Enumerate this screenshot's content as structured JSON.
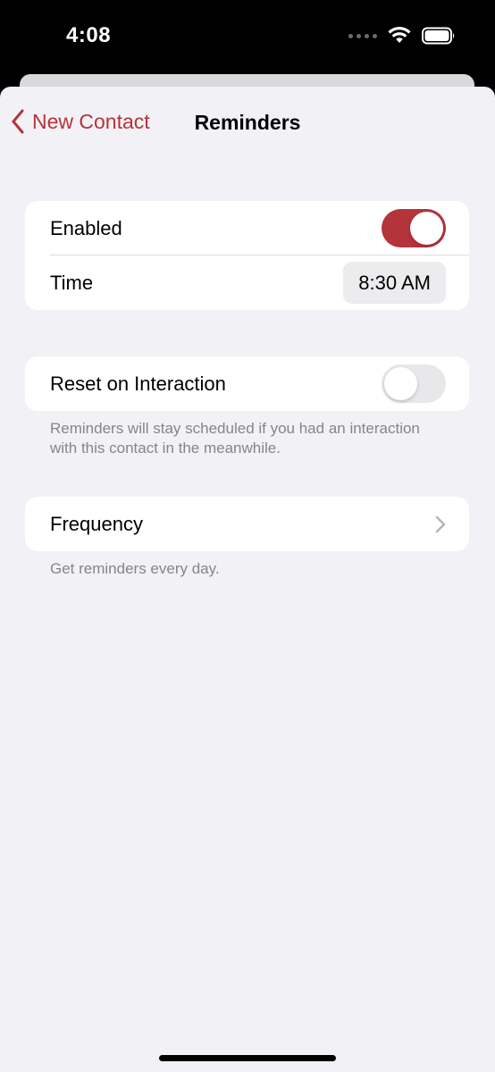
{
  "status_bar": {
    "time": "4:08"
  },
  "nav": {
    "back_label": "New Contact",
    "title": "Reminders"
  },
  "group1": {
    "enabled_label": "Enabled",
    "enabled_on": true,
    "time_label": "Time",
    "time_value": "8:30 AM"
  },
  "group2": {
    "reset_label": "Reset on Interaction",
    "reset_on": false,
    "footer": "Reminders will stay scheduled if you had an interaction with this contact in the meanwhile."
  },
  "group3": {
    "frequency_label": "Frequency",
    "footer": "Get reminders every day."
  },
  "colors": {
    "accent": "#b5333b",
    "background": "#f2f1f6",
    "secondary_text": "#85858a"
  }
}
